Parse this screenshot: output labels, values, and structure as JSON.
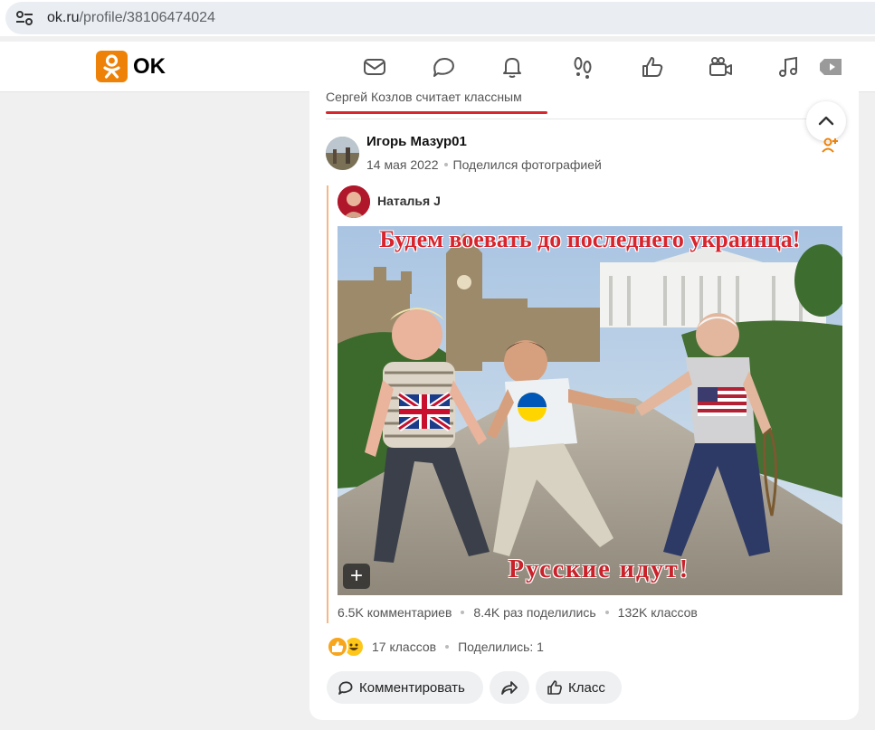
{
  "browser": {
    "url_host": "ok.ru",
    "url_path": "/profile/38106474024"
  },
  "header": {
    "logo_text": "OK",
    "nav": [
      "mail-icon",
      "chat-icon",
      "bell-icon",
      "footprints-icon",
      "like-icon",
      "video-camera-icon",
      "music-icon",
      "video-play-icon"
    ]
  },
  "feed": {
    "liked_by": "Сергей Козлов считает классным",
    "post": {
      "author": "Игорь Мазур01",
      "date": "14 мая 2022",
      "action": "Поделился фотографией",
      "original_author": "Наталья J",
      "photo": {
        "caption_top": "Будем воевать до последнего украинца!",
        "caption_bottom": "Русские идут!"
      },
      "stats": {
        "comments": "6.5K комментариев",
        "shares": "8.4K раз поделились",
        "klass": "132K классов"
      },
      "reactions": {
        "klass_count": "17 классов",
        "shared": "Поделились: 1"
      },
      "actions": {
        "comment": "Комментировать",
        "klass": "Класс"
      }
    }
  },
  "colors": {
    "brand": "#ee8208",
    "accent_red": "#d9262c"
  }
}
